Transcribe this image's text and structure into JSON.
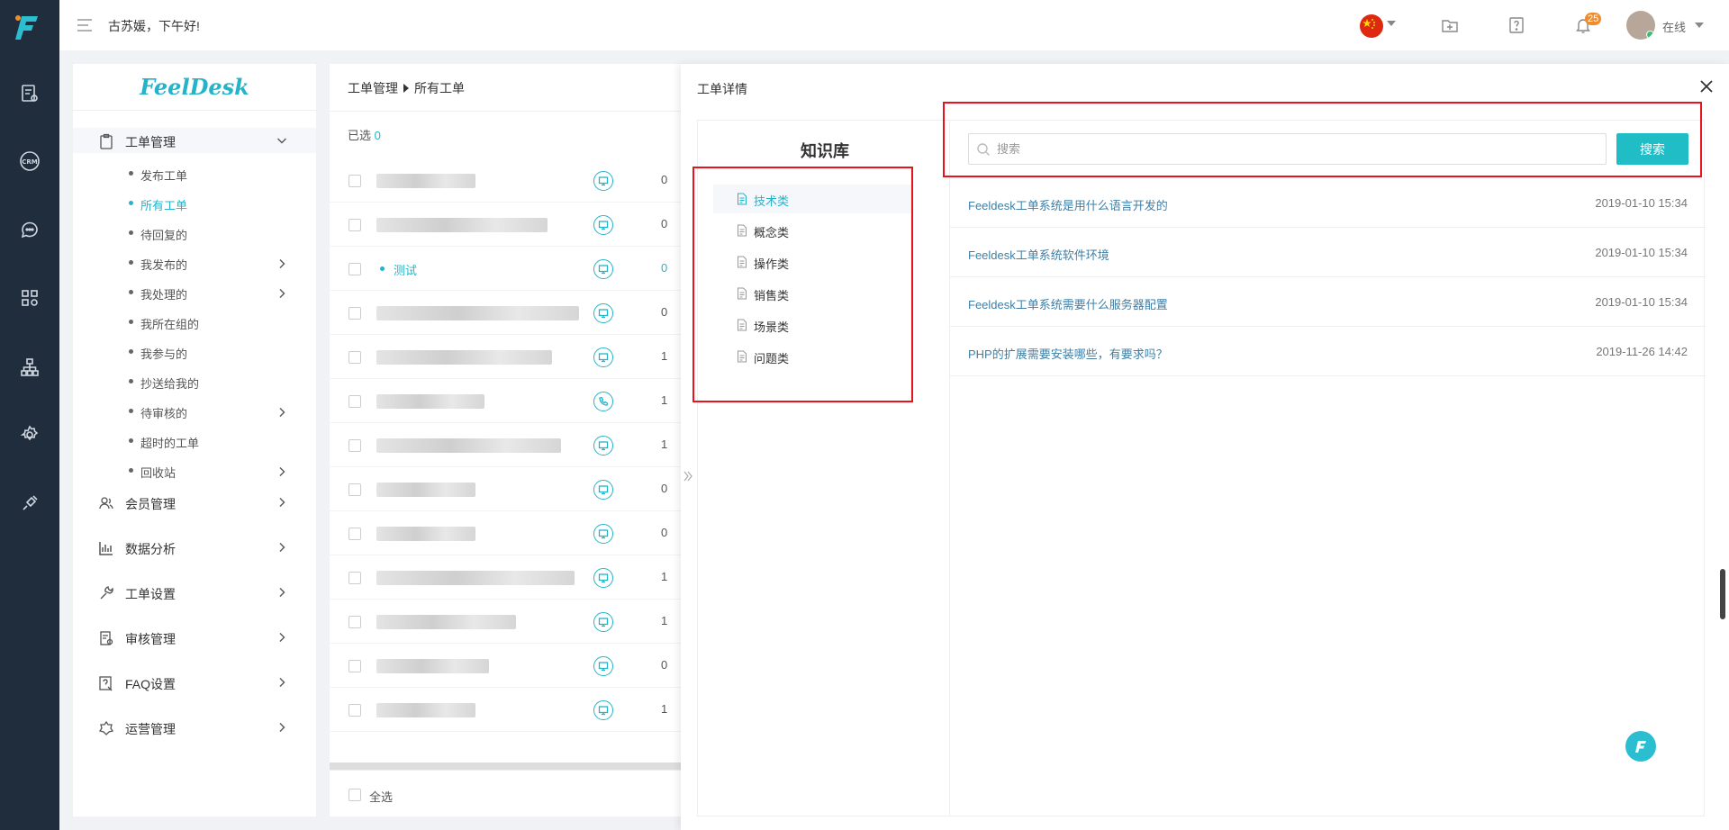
{
  "topbar": {
    "greeting": "古苏媛，下午好!",
    "notification_count": "25",
    "status": "在线"
  },
  "brand": {
    "name": "FeelDesk"
  },
  "sidebar": {
    "groups": [
      {
        "label": "工单管理",
        "icon": "clipboard-icon",
        "expanded": true
      },
      {
        "label": "会员管理",
        "icon": "users-icon"
      },
      {
        "label": "数据分析",
        "icon": "bar-chart-icon"
      },
      {
        "label": "工单设置",
        "icon": "wrench-icon"
      },
      {
        "label": "审核管理",
        "icon": "audit-icon"
      },
      {
        "label": "FAQ设置",
        "icon": "faq-icon"
      },
      {
        "label": "运营管理",
        "icon": "operations-icon"
      }
    ],
    "sub_items": [
      {
        "label": "发布工单"
      },
      {
        "label": "所有工单",
        "selected": true
      },
      {
        "label": "待回复的"
      },
      {
        "label": "我发布的",
        "has_children": true
      },
      {
        "label": "我处理的",
        "has_children": true
      },
      {
        "label": "我所在组的"
      },
      {
        "label": "我参与的"
      },
      {
        "label": "抄送给我的"
      },
      {
        "label": "待审核的",
        "has_children": true
      },
      {
        "label": "超时的工单"
      },
      {
        "label": "回收站",
        "has_children": true
      }
    ]
  },
  "ticket_list": {
    "breadcrumb": [
      "工单管理",
      "所有工单"
    ],
    "selected_label": "已选",
    "selected_count": "0",
    "rows": [
      {
        "title": "",
        "channel": "web",
        "count": "0"
      },
      {
        "title": "",
        "channel": "web",
        "count": "0"
      },
      {
        "title": "测试",
        "channel": "web",
        "count": "0"
      },
      {
        "title": "",
        "channel": "web",
        "count": "0"
      },
      {
        "title": "",
        "channel": "web",
        "count": "1"
      },
      {
        "title": "",
        "channel": "phone",
        "count": "1"
      },
      {
        "title": "",
        "channel": "web",
        "count": "1"
      },
      {
        "title": "",
        "channel": "web",
        "count": "0"
      },
      {
        "title": "",
        "channel": "web",
        "count": "0"
      },
      {
        "title": "",
        "channel": "web",
        "count": "1"
      },
      {
        "title": "",
        "channel": "web",
        "count": "1"
      },
      {
        "title": "",
        "channel": "web",
        "count": "0"
      },
      {
        "title": "",
        "channel": "web",
        "count": "1"
      }
    ],
    "select_all": "全选"
  },
  "detail_panel": {
    "title": "工单详情",
    "knowledge_base": {
      "title": "知识库",
      "categories": [
        {
          "label": "技术类",
          "active": true
        },
        {
          "label": "概念类"
        },
        {
          "label": "操作类"
        },
        {
          "label": "销售类"
        },
        {
          "label": "场景类"
        },
        {
          "label": "问题类"
        }
      ]
    },
    "search": {
      "placeholder": "搜索",
      "button": "搜索"
    },
    "articles": [
      {
        "title": "Feeldesk工单系统是用什么语言开发的",
        "date": "2019-01-10 15:34"
      },
      {
        "title": "Feeldesk工单系统软件环境",
        "date": "2019-01-10 15:34"
      },
      {
        "title": "Feeldesk工单系统需要什么服务器配置",
        "date": "2019-01-10 15:34"
      },
      {
        "title": "PHP的扩展需要安装哪些，有要求吗？",
        "date": "2019-11-26 14:42"
      }
    ]
  },
  "colors": {
    "accent": "#24b4c9",
    "rail": "#1f2d3d",
    "highlight_box": "#e8141c",
    "badge": "#f08c2c"
  }
}
